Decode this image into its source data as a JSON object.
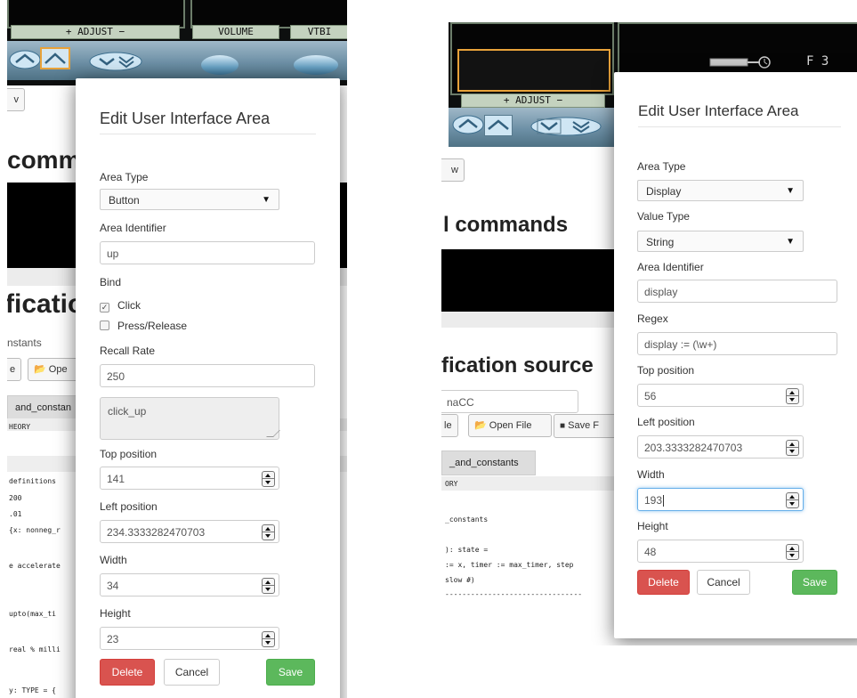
{
  "left_background": {
    "adjust_label": "+  ADJUST  −",
    "volume_label": "VOLUME",
    "vtbi_label": "VTBI",
    "small_button_label": "v",
    "heading_1": "comm",
    "heading_2": "ficatio",
    "row_text": "nstants",
    "btn_text": "e",
    "open_file_label": "Ope",
    "tab_label": "and_constan",
    "code_lines": [
      "HEORY",
      "definitions",
      "200",
      ".01",
      "{x: nonneg_r",
      "e accelerate",
      "upto(max_ti",
      "real % milli",
      "y: TYPE = {"
    ]
  },
  "left_modal": {
    "title": "Edit User Interface Area",
    "area_type_label": "Area Type",
    "area_type_value": "Button",
    "area_identifier_label": "Area Identifier",
    "area_identifier_value": "up",
    "bind_label": "Bind",
    "bind_options": [
      {
        "label": "Click",
        "checked": true
      },
      {
        "label": "Press/Release",
        "checked": false
      }
    ],
    "recall_rate_label": "Recall Rate",
    "recall_rate_value": "250",
    "textarea_value": "click_up",
    "top_label": "Top position",
    "top_value": "141",
    "left_label": "Left position",
    "left_value": "234.3333282470703",
    "width_label": "Width",
    "width_value": "34",
    "height_label": "Height",
    "height_value": "23",
    "delete_label": "Delete",
    "cancel_label": "Cancel",
    "save_label": "Save"
  },
  "right_background": {
    "adjust_label": "+  ADJUST  −",
    "display_glyphs": "F  3",
    "small_button_label": "w",
    "heading_1": "l commands",
    "heading_2": "fication source",
    "input_value": "naCC",
    "btn_text": "le",
    "open_file_label": "Open File",
    "save_file_label": "Save F",
    "tab_label": "_and_constants",
    "code_lines": [
      "ORY",
      "_constants",
      "): state =",
      ":= x, timer := max_timer, step",
      "slow #)",
      "--------------------------------"
    ]
  },
  "right_modal": {
    "title": "Edit User Interface Area",
    "area_type_label": "Area Type",
    "area_type_value": "Display",
    "value_type_label": "Value Type",
    "value_type_value": "String",
    "area_identifier_label": "Area Identifier",
    "area_identifier_value": "display",
    "regex_label": "Regex",
    "regex_value": "display := (\\w+)",
    "top_label": "Top position",
    "top_value": "56",
    "left_label": "Left position",
    "left_value": "203.3333282470703",
    "width_label": "Width",
    "width_value": "193",
    "height_label": "Height",
    "height_value": "48",
    "delete_label": "Delete",
    "cancel_label": "Cancel",
    "save_label": "Save"
  },
  "colors": {
    "delete": "#d9534f",
    "save": "#5cb85c",
    "focus": "#66afe9",
    "lcd_frame": "#6c7d6a",
    "device_blue": "#6d90a6",
    "orange_highlight": "#e8a23a"
  }
}
